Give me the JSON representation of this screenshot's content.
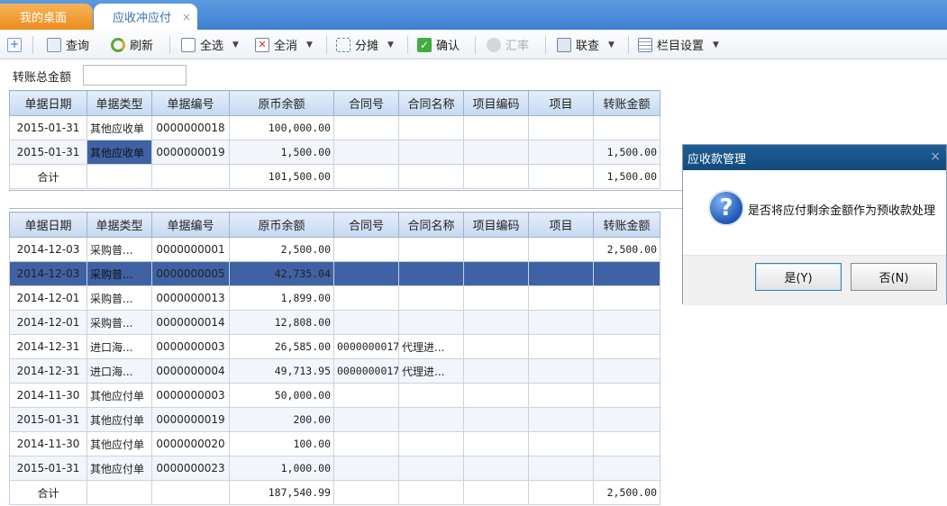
{
  "tabs": {
    "desktop": "我的桌面",
    "active": "应收冲应付",
    "close_glyph": "×"
  },
  "toolbar": {
    "query": "查询",
    "refresh": "刷新",
    "select_all": "全选",
    "deselect_all": "全消",
    "split": "分摊",
    "confirm": "确认",
    "exchange_rate": "汇率",
    "linked_query": "联查",
    "column_settings": "栏目设置"
  },
  "transfer_total": {
    "label": "转账总金额",
    "value": ""
  },
  "headers": [
    "单据日期",
    "单据类型",
    "单据编号",
    "原币余额",
    "合同号",
    "合同名称",
    "项目编码",
    "项目",
    "转账金额"
  ],
  "receivables": {
    "rows": [
      [
        "2015-01-31",
        "其他应收单",
        "0000000018",
        "100,000.00",
        "",
        "",
        "",
        "",
        ""
      ],
      [
        "2015-01-31",
        "其他应收单",
        "0000000019",
        "1,500.00",
        "",
        "",
        "",
        "",
        "1,500.00"
      ]
    ],
    "total": [
      "合计",
      "",
      "",
      "101,500.00",
      "",
      "",
      "",
      "",
      "1,500.00"
    ]
  },
  "payables": {
    "rows": [
      [
        "2014-12-03",
        "采购普...",
        "0000000001",
        "2,500.00",
        "",
        "",
        "",
        "",
        "2,500.00"
      ],
      [
        "2014-12-03",
        "采购普...",
        "0000000005",
        "42,735.04",
        "",
        "",
        "",
        "",
        ""
      ],
      [
        "2014-12-01",
        "采购普...",
        "0000000013",
        "1,899.00",
        "",
        "",
        "",
        "",
        ""
      ],
      [
        "2014-12-01",
        "采购普...",
        "0000000014",
        "12,808.00",
        "",
        "",
        "",
        "",
        ""
      ],
      [
        "2014-12-31",
        "进口海...",
        "0000000003",
        "26,585.00",
        "0000000017",
        "代理进...",
        "",
        "",
        ""
      ],
      [
        "2014-12-31",
        "进口海...",
        "0000000004",
        "49,713.95",
        "0000000017",
        "代理进...",
        "",
        "",
        ""
      ],
      [
        "2014-11-30",
        "其他应付单",
        "0000000003",
        "50,000.00",
        "",
        "",
        "",
        "",
        ""
      ],
      [
        "2015-01-31",
        "其他应付单",
        "0000000019",
        "200.00",
        "",
        "",
        "",
        "",
        ""
      ],
      [
        "2014-11-30",
        "其他应付单",
        "0000000020",
        "100.00",
        "",
        "",
        "",
        "",
        ""
      ],
      [
        "2015-01-31",
        "其他应付单",
        "0000000023",
        "1,000.00",
        "",
        "",
        "",
        "",
        ""
      ]
    ],
    "total": [
      "合计",
      "",
      "",
      "187,540.99",
      "",
      "",
      "",
      "",
      "2,500.00"
    ]
  },
  "dialog": {
    "title": "应收款管理",
    "message": "是否将应付剩余金额作为预收款处理",
    "yes": "是(Y)",
    "no": "否(N)",
    "close_glyph": "×",
    "icon_glyph": "?"
  },
  "colors": {
    "selection": "#3f62a4",
    "dialog_title": "#1d5f96",
    "tab_active": "#ec8c1d"
  },
  "icons": [
    "add-icon",
    "query-icon",
    "refresh-icon",
    "select-all-icon",
    "deselect-all-icon",
    "split-icon",
    "confirm-icon",
    "exchange-rate-icon",
    "linked-query-icon",
    "column-settings-icon",
    "question-icon"
  ]
}
